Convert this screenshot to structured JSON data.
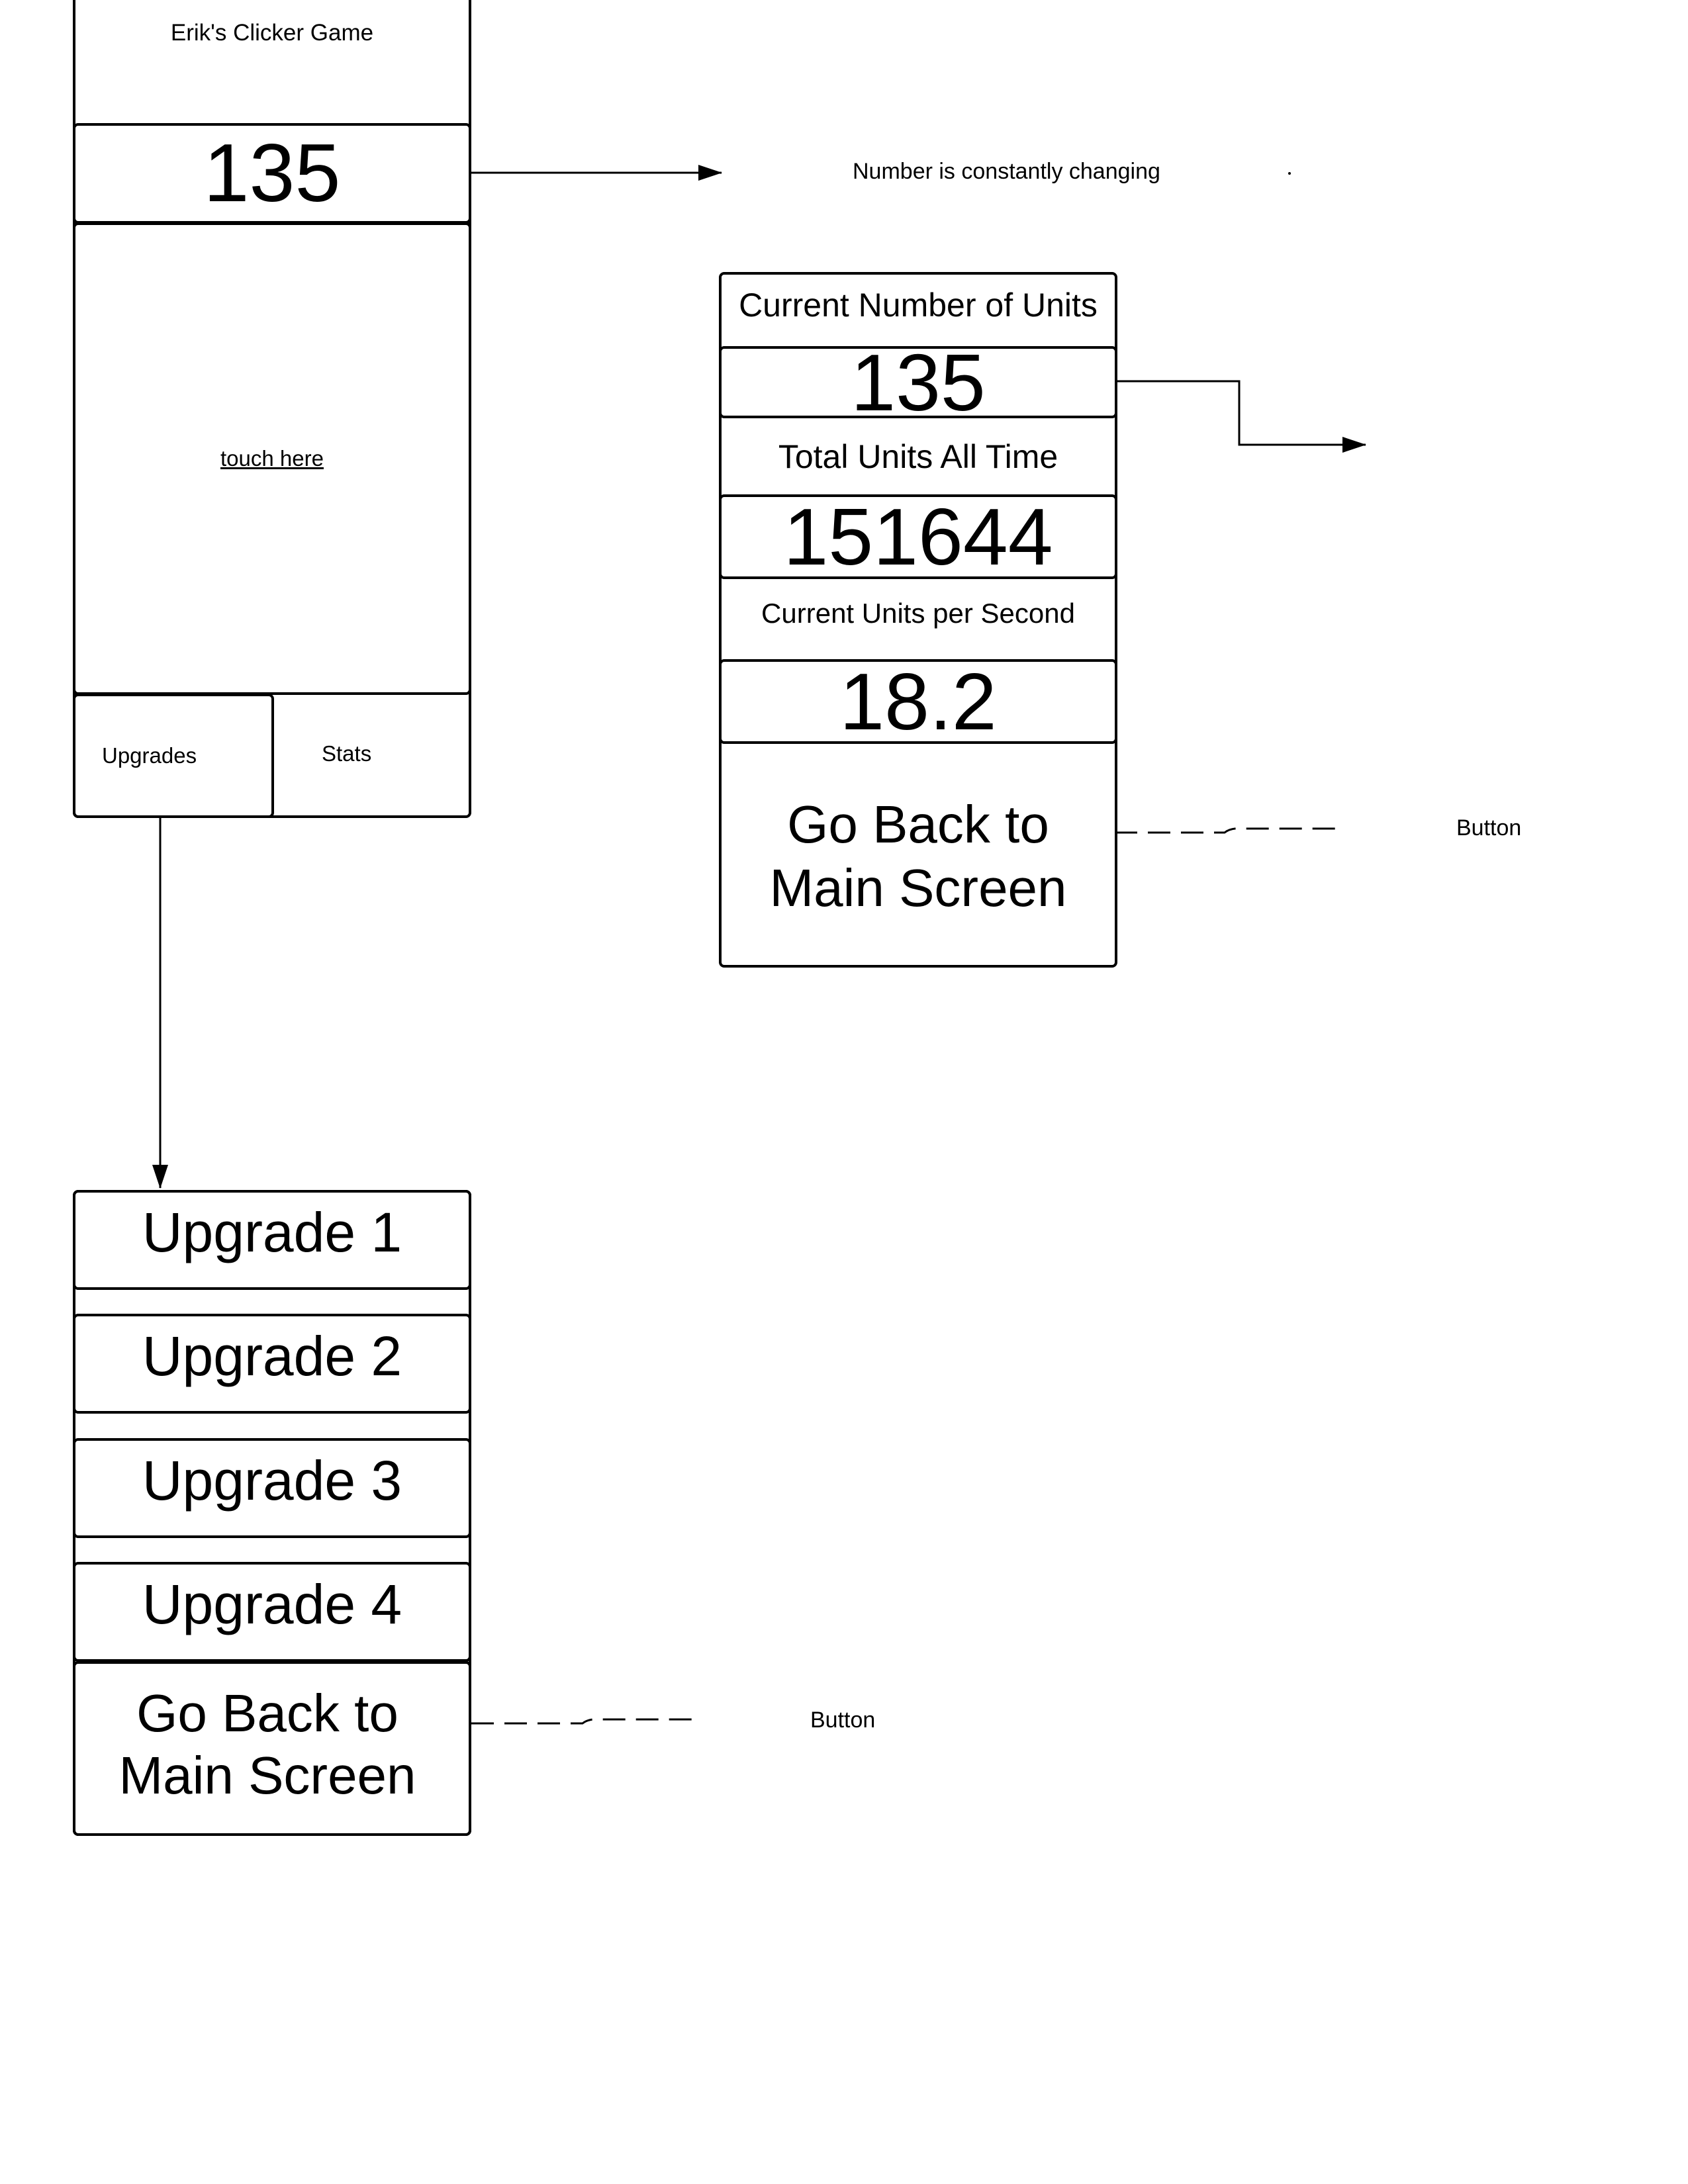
{
  "main_screen": {
    "title": "Erik's Clicker Game",
    "counter": "135",
    "touch_label": "touch here",
    "upgrades_tab": "Upgrades",
    "stats_tab": "Stats"
  },
  "stats_screen": {
    "current_units_label": "Current Number of Units",
    "current_units_value": "135",
    "total_units_label": "Total Units All Time",
    "total_units_value": "151644",
    "units_per_second_label": "Current Units per Second",
    "units_per_second_value": "18.2",
    "back_button": "Go Back to Main Screen"
  },
  "upgrades_screen": {
    "items": [
      "Upgrade 1",
      "Upgrade 2",
      "Upgrade 3",
      "Upgrade 4"
    ],
    "back_button": "Go Back to Main Screen"
  },
  "annotations": {
    "counter_note": "Number is constantly changing",
    "stats_button_note": "Button",
    "upgrades_button_note": "Button"
  }
}
